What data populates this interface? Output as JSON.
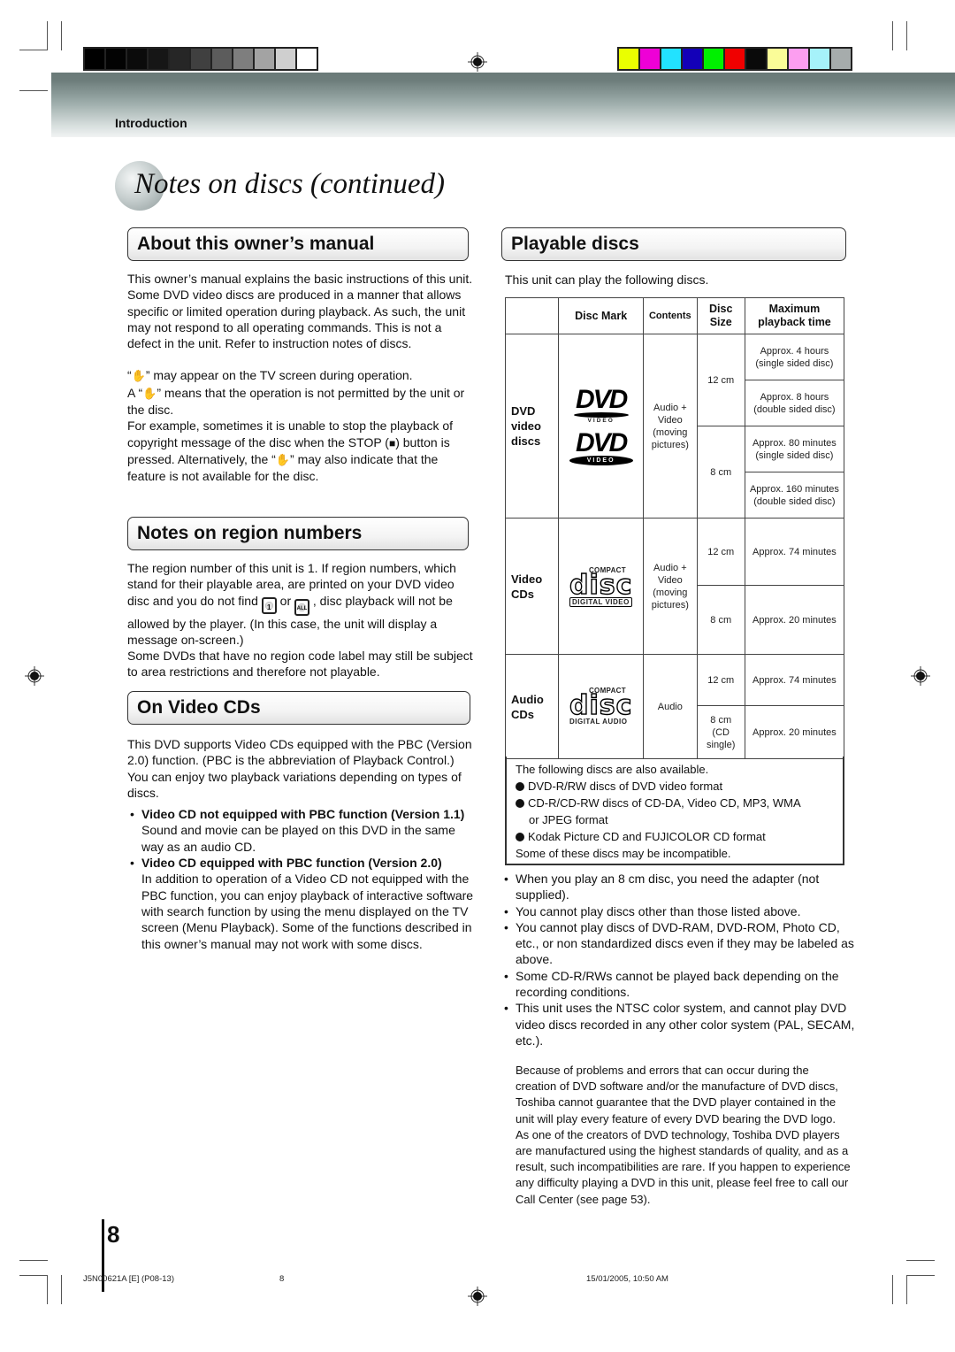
{
  "header": {
    "section_label": "Introduction",
    "gray_swatches": [
      "#000000",
      "#030303",
      "#0b0b0b",
      "#161616",
      "#262626",
      "#404040",
      "#5c5c5c",
      "#7e7e7e",
      "#a3a3a3",
      "#cfcfcf",
      "#ffffff"
    ],
    "color_swatches": [
      "#eaff00",
      "#ee00d6",
      "#22e2ff",
      "#1300b8",
      "#00f000",
      "#f00000",
      "#0a0a0a",
      "#fafc98",
      "#fc9ef0",
      "#a6f2fa",
      "#a6acac"
    ]
  },
  "page_title": "Notes on discs (continued)",
  "about": {
    "heading": "About this owner’s manual",
    "para1": "This owner’s manual explains the basic instructions of this unit. Some DVD video discs are produced in a manner that allows specific or limited operation during playback. As such, the unit may not respond to all operating commands. This is not a defect in the unit. Refer to instruction notes of discs.",
    "para2_a": "“",
    "para2_b": "” may appear on the TV screen during operation.",
    "para3_a": "A “",
    "para3_b": "” means that the operation is not permitted by the unit or the disc.",
    "para4_a": "For example, sometimes it is unable to stop the playback of copyright message of the disc when the STOP (",
    "para4_b": ") button is pressed. Alternatively, the “",
    "para4_c": "” may also indicate that the feature is not available for the disc.",
    "hand_icon": "✋",
    "stop_icon": "■"
  },
  "region": {
    "heading": "Notes on region numbers",
    "text_a": "The region number of this unit is 1. If region numbers, which stand for their playable area, are printed on your DVD video disc and you do not find ",
    "icon1_label": "1",
    "text_or": " or ",
    "icon2_label": "ALL",
    "text_b": " , disc playback will not be allowed by the player. (In this case, the unit will display a message on-screen.)",
    "text_c": "Some DVDs that have no region code label may still be subject to area restrictions and therefore not playable."
  },
  "vcd": {
    "heading": "On Video CDs",
    "intro": "This DVD supports Video CDs equipped with the PBC (Version 2.0) function. (PBC is the abbreviation of Playback Control.) You can enjoy two playback variations depending on types of discs.",
    "bullets": [
      {
        "title": "Video CD not equipped with PBC function (Version 1.1)",
        "text": "Sound and movie can be played on this DVD in the same way as an audio CD."
      },
      {
        "title": "Video CD equipped with PBC function (Version 2.0)",
        "text": "In addition to operation of a Video CD not equipped with the PBC function, you can enjoy playback of interactive software with search function by using the menu displayed on the TV screen (Menu Playback). Some of the functions described in this owner’s manual may not work with some discs."
      }
    ]
  },
  "playable": {
    "heading": "Playable discs",
    "intro": "This unit can play the following discs.",
    "columns": [
      "",
      "Disc Mark",
      "Contents",
      "Disc Size",
      "Maximum playback time"
    ],
    "rows": [
      {
        "type": "DVD video discs",
        "logo": "DVD VIDEO",
        "logo_sub": "VIDEO",
        "contents": "Audio + Video (moving pictures)",
        "sizes": [
          {
            "size": "12 cm",
            "times": [
              "Approx. 4 hours (single sided disc)",
              "Approx. 8 hours (double sided disc)"
            ]
          },
          {
            "size": "8 cm",
            "times": [
              "Approx. 80 minutes (single sided disc)",
              "Approx. 160 minutes (double sided disc)"
            ]
          }
        ]
      },
      {
        "type": "Video CDs",
        "logo_top": "COMPACT",
        "logo_main": "disc",
        "logo_sub": "DIGITAL VIDEO",
        "contents": "Audio + Video (moving pictures)",
        "sizes": [
          {
            "size": "12 cm",
            "times": [
              "Approx. 74 minutes"
            ]
          },
          {
            "size": "8 cm",
            "times": [
              "Approx. 20 minutes"
            ]
          }
        ]
      },
      {
        "type": "Audio CDs",
        "logo_top": "COMPACT",
        "logo_main": "disc",
        "logo_sub": "DIGITAL AUDIO",
        "contents": "Audio",
        "sizes": [
          {
            "size": "12 cm",
            "times": [
              "Approx. 74 minutes"
            ]
          },
          {
            "size": "8 cm (CD single)",
            "times": [
              "Approx. 20 minutes"
            ]
          }
        ]
      }
    ],
    "also": {
      "intro": "The following discs are also available.",
      "items": [
        "DVD-R/RW discs of DVD video format",
        "CD-R/CD-RW discs of CD-DA, Video CD, MP3, WMA",
        "or JPEG format",
        "Kodak Picture CD and FUJICOLOR CD format"
      ],
      "note": "Some of these discs may be incompatible."
    },
    "notes": [
      "When you play an 8 cm disc, you need the adapter (not supplied).",
      "You cannot play discs other than those listed above.",
      "You cannot play discs of DVD-RAM, DVD-ROM, Photo CD, etc., or non standardized discs even if they may be labeled as above.",
      "Some CD-R/RWs cannot be played back depending on the recording conditions.",
      "This unit uses the NTSC color system, and cannot play DVD video discs recorded in any other color system (PAL, SECAM, etc.)."
    ],
    "disclaimer": "Because of problems and errors that can occur during the creation of DVD software and/or the manufacture of DVD discs, Toshiba cannot guarantee that the DVD player contained in the unit will play every feature of every DVD bearing the DVD logo.  As one of the creators of DVD technology, Toshiba DVD players are manufactured using the highest standards of quality, and as a result, such incompatibilities are rare.  If you happen to experience any difficulty playing a DVD in this unit, please feel free to call our Call Center (see page 53)."
  },
  "footer": {
    "page_number": "8",
    "doc_code": "J5N00621A [E] (P08-13)",
    "center_page": "8",
    "timestamp": "15/01/2005, 10:50 AM"
  }
}
